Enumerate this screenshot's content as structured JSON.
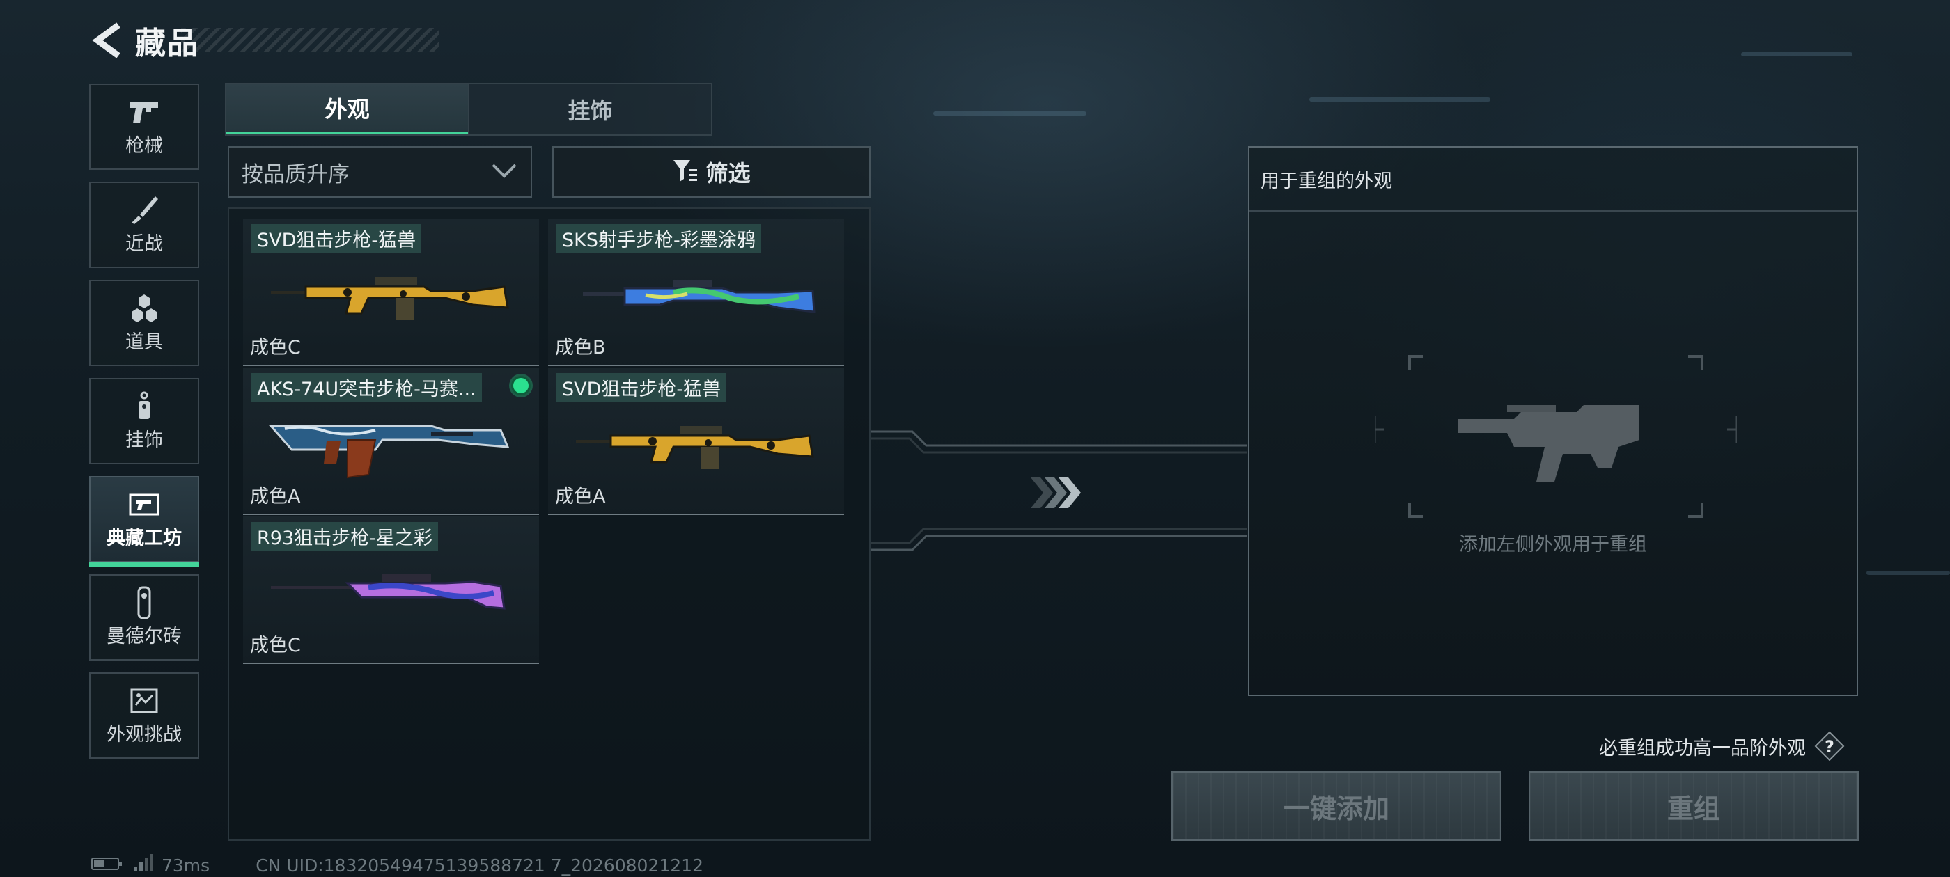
{
  "header": {
    "title": "藏品"
  },
  "sidebar": {
    "items": [
      {
        "label": "枪械",
        "icon": "pistol-icon"
      },
      {
        "label": "近战",
        "icon": "knife-icon"
      },
      {
        "label": "道具",
        "icon": "grenades-icon"
      },
      {
        "label": "挂饰",
        "icon": "charm-icon"
      },
      {
        "label": "典藏工坊",
        "icon": "workshop-icon",
        "active": true
      },
      {
        "label": "曼德尔砖",
        "icon": "mandel-brick-icon"
      },
      {
        "label": "外观挑战",
        "icon": "challenge-icon"
      }
    ]
  },
  "tabs": [
    {
      "label": "外观",
      "active": true
    },
    {
      "label": "挂饰",
      "active": false
    }
  ],
  "sort": {
    "value": "按品质升序"
  },
  "filter": {
    "label": "筛选"
  },
  "skins": [
    {
      "name": "SVD狙击步枪-猛兽",
      "grade": "成色C",
      "skin_colors": [
        "#d9a52c",
        "#1b1a12"
      ]
    },
    {
      "name": "SKS射手步枪-彩墨涂鸦",
      "grade": "成色B",
      "skin_colors": [
        "#3d7de0",
        "#45c870"
      ]
    },
    {
      "name": "AKS-74U突击步枪-马赛...",
      "grade": "成色A",
      "equipped": true,
      "skin_colors": [
        "#2a5d86",
        "#8a3a1c"
      ]
    },
    {
      "name": "SVD狙击步枪-猛兽",
      "grade": "成色A",
      "skin_colors": [
        "#d9a52c",
        "#1b1a12"
      ]
    },
    {
      "name": "R93狙击步枪-星之彩",
      "grade": "成色C",
      "skin_colors": [
        "#b56ee0",
        "#3b47c8"
      ]
    }
  ],
  "recombine": {
    "header": "用于重组的外观",
    "hint": "添加左侧外观用于重组",
    "guarantee": "必重组成功高一品阶外观",
    "auto_add_label": "一键添加",
    "recombine_label": "重组"
  },
  "status": {
    "ping": "73ms",
    "uid": "CN UID:18320549475139588721 7_202608021212"
  },
  "colors": {
    "accent": "#43d49a",
    "equipped": "#2be08f"
  }
}
